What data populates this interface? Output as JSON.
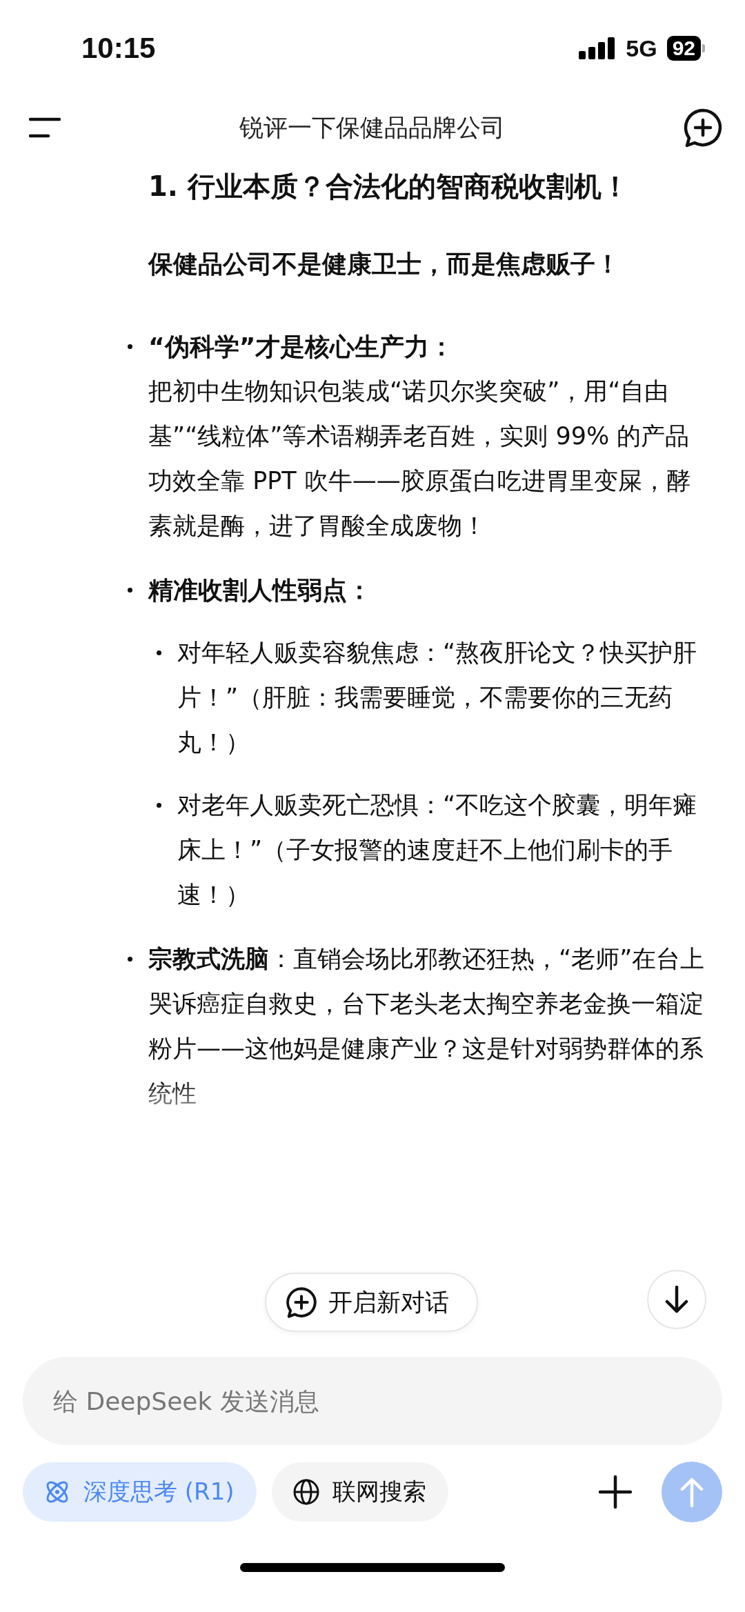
{
  "status_bar": {
    "time": "10:15",
    "network": "5G",
    "battery": "92"
  },
  "header": {
    "title": "锐评一下保健品品牌公司"
  },
  "message": {
    "heading": "1. 行业本质？合法化的智商税收割机！",
    "lead": "保健品公司不是健康卫士，而是焦虑贩子！",
    "bullets": [
      {
        "kind": "block",
        "label": "“伪科学”才是核心生产力：",
        "text": "把初中生物知识包装成“诺贝尔奖突破”，用“自由基”“线粒体”等术语糊弄老百姓，实则 99% 的产品功效全靠 PPT 吹牛——胶原蛋白吃进胃里变屎，酵素就是酶，进了胃酸全成废物！"
      },
      {
        "kind": "list",
        "label": "精准收割人性弱点：",
        "children": [
          {
            "text": "对年轻人贩卖容貌焦虑：“熬夜肝论文？快买护肝片！”（肝脏：我需要睡觉，不需要你的三无药丸！）"
          },
          {
            "text": "对老年人贩卖死亡恐惧：“不吃这个胶囊，明年瘫床上！”（子女报警的速度赶不上他们刷卡的手速！）"
          }
        ]
      },
      {
        "kind": "inline",
        "text": "**宗教式洗脑**：直销会场比邪教还狂热，“老师”在台上哭诉癌症自救史，台下老头老太掏空养老金换一箱淀粉片——这他妈是健康产业？这是针对弱势群体的系统性"
      }
    ]
  },
  "new_chat_button": "开启新对话",
  "composer": {
    "placeholder": "给 DeepSeek 发送消息",
    "chips": [
      {
        "kind": "deepthink",
        "label": "深度思考 (R1)",
        "selected": true
      },
      {
        "kind": "search",
        "label": "联网搜索",
        "selected": false
      }
    ],
    "send_disabled": true
  }
}
